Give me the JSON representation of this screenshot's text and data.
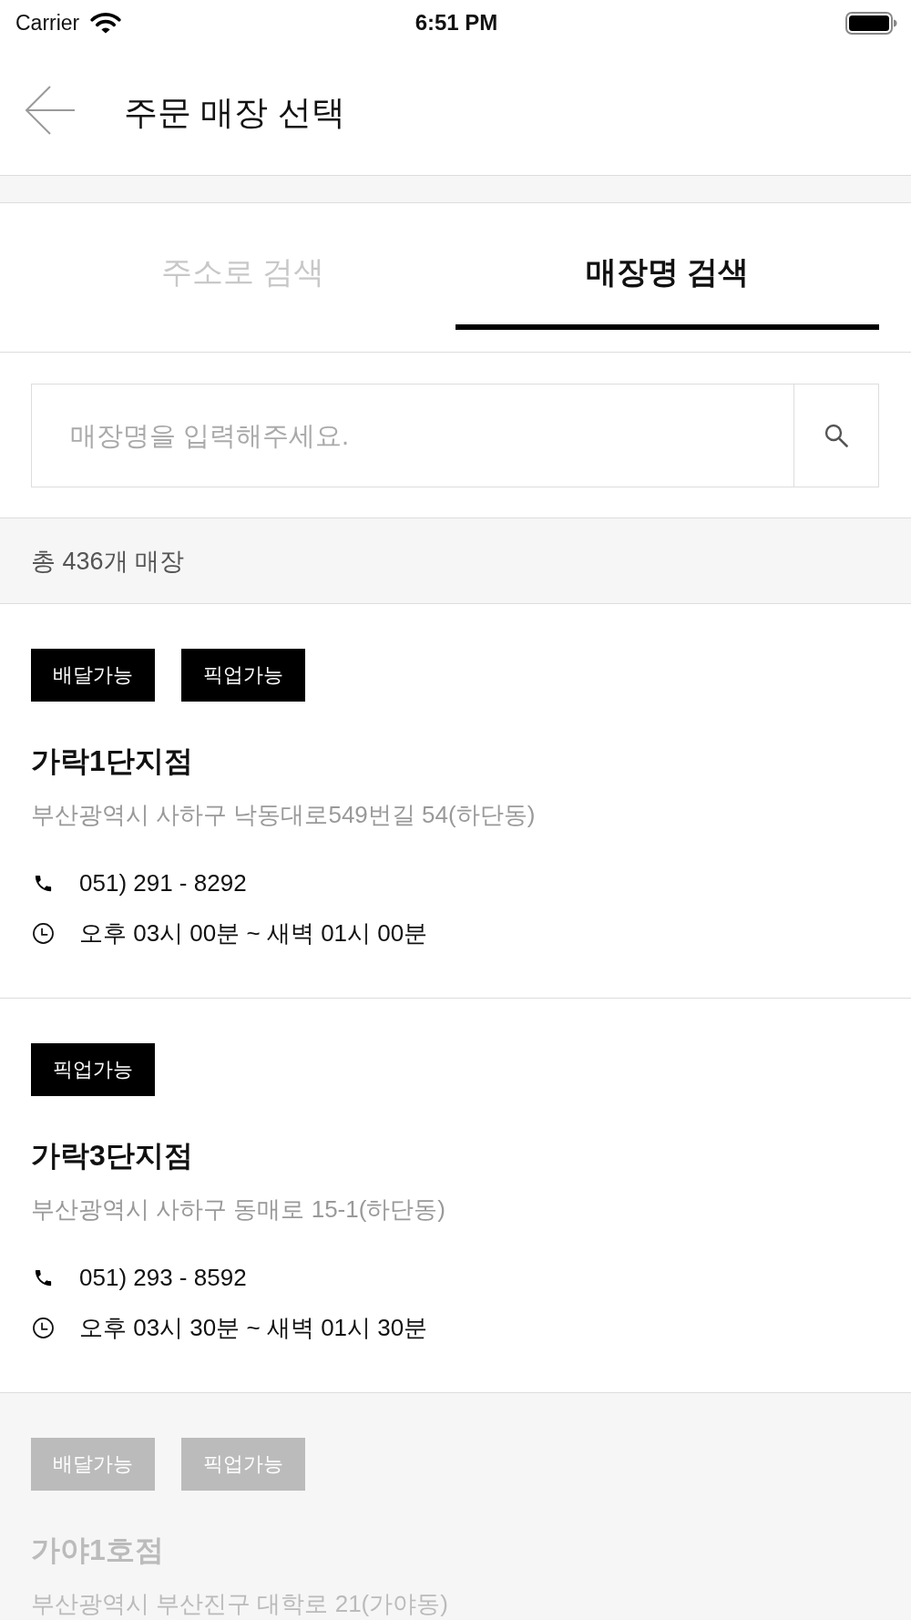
{
  "status_bar": {
    "carrier": "Carrier",
    "time": "6:51 PM"
  },
  "header": {
    "title": "주문 매장 선택"
  },
  "tabs": [
    {
      "label": "주소로 검색",
      "selected": false
    },
    {
      "label": "매장명 검색",
      "selected": true
    }
  ],
  "search": {
    "placeholder": "매장명을 입력해주세요."
  },
  "store_count": "총 436개 매장",
  "stores": [
    {
      "disabled": false,
      "tags": [
        "배달가능",
        "픽업가능"
      ],
      "name": "가락1단지점",
      "address": "부산광역시 사하구 낙동대로549번길 54(하단동)",
      "phone": "051) 291 - 8292",
      "hours": "오후 03시 00분 ~ 새벽 01시 00분"
    },
    {
      "disabled": false,
      "tags": [
        "픽업가능"
      ],
      "name": "가락3단지점",
      "address": "부산광역시 사하구 동매로 15-1(하단동)",
      "phone": "051) 293 - 8592",
      "hours": "오후 03시 30분 ~ 새벽 01시 30분"
    },
    {
      "disabled": true,
      "tags": [
        "배달가능",
        "픽업가능"
      ],
      "name": "가야1호점",
      "address": "부산광역시 부산진구 대학로 21(가야동)"
    }
  ]
}
